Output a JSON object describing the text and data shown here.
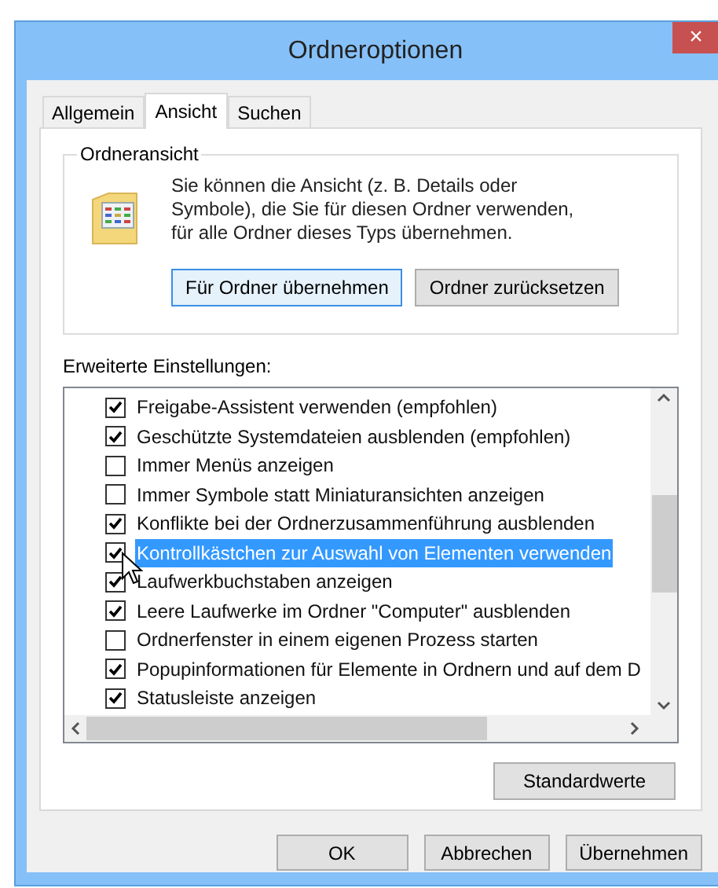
{
  "window": {
    "title": "Ordneroptionen",
    "close": "×"
  },
  "tabs": [
    {
      "label": "Allgemein",
      "selected": false
    },
    {
      "label": "Ansicht",
      "selected": true
    },
    {
      "label": "Suchen",
      "selected": false
    }
  ],
  "folder_view": {
    "legend": "Ordneransicht",
    "description": "Sie können die Ansicht (z. B. Details oder Symbole), die Sie für diesen Ordner verwenden, für alle Ordner dieses Typs übernehmen.",
    "buttons": [
      {
        "label": "Für Ordner übernehmen",
        "focused": true
      },
      {
        "label": "Ordner zurücksetzen",
        "focused": false
      }
    ]
  },
  "advanced": {
    "label": "Erweiterte Einstellungen:",
    "items": [
      {
        "label": "Freigabe-Assistent verwenden (empfohlen)",
        "checked": true,
        "selected": false
      },
      {
        "label": "Geschützte Systemdateien ausblenden (empfohlen)",
        "checked": true,
        "selected": false
      },
      {
        "label": "Immer Menüs anzeigen",
        "checked": false,
        "selected": false
      },
      {
        "label": "Immer Symbole statt Miniaturansichten anzeigen",
        "checked": false,
        "selected": false
      },
      {
        "label": "Konflikte bei der Ordnerzusammenführung ausblenden",
        "checked": true,
        "selected": false
      },
      {
        "label": "Kontrollkästchen zur Auswahl von Elementen verwenden",
        "checked": true,
        "selected": true
      },
      {
        "label": "Laufwerkbuchstaben anzeigen",
        "checked": true,
        "selected": false
      },
      {
        "label": "Leere Laufwerke im Ordner \"Computer\" ausblenden",
        "checked": true,
        "selected": false
      },
      {
        "label": "Ordnerfenster in einem eigenen Prozess starten",
        "checked": false,
        "selected": false
      },
      {
        "label": "Popupinformationen für Elemente in Ordnern und auf dem D",
        "checked": true,
        "selected": false
      },
      {
        "label": "Statusleiste anzeigen",
        "checked": true,
        "selected": false
      }
    ],
    "defaults_button": "Standardwerte"
  },
  "buttons": [
    "OK",
    "Abbrechen",
    "Übernehmen"
  ]
}
